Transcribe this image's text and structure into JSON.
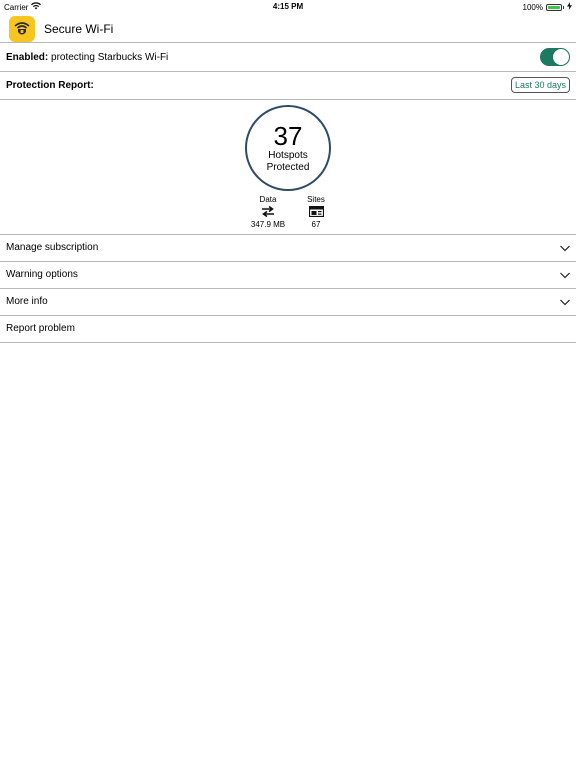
{
  "status_bar": {
    "carrier": "Carrier",
    "time": "4:15 PM",
    "battery": "100%"
  },
  "header": {
    "title": "Secure Wi-Fi"
  },
  "enabled": {
    "label": "Enabled:",
    "text": " protecting Starbucks Wi-Fi",
    "on": true
  },
  "report": {
    "title": "Protection Report:",
    "range": "Last 30 days"
  },
  "stats": {
    "hotspots": {
      "count": "37",
      "line1": "Hotspots",
      "line2": "Protected"
    },
    "data": {
      "label": "Data",
      "value": "347.9 MB"
    },
    "sites": {
      "label": "Sites",
      "value": "67"
    }
  },
  "menu": [
    {
      "label": "Manage subscription",
      "chevron": true
    },
    {
      "label": "Warning options",
      "chevron": true
    },
    {
      "label": "More info",
      "chevron": true
    },
    {
      "label": "Report problem",
      "chevron": false
    }
  ],
  "colors": {
    "accent": "#1c7a63",
    "circle": "#2f4a6b",
    "app_icon": "#f7c51e"
  }
}
